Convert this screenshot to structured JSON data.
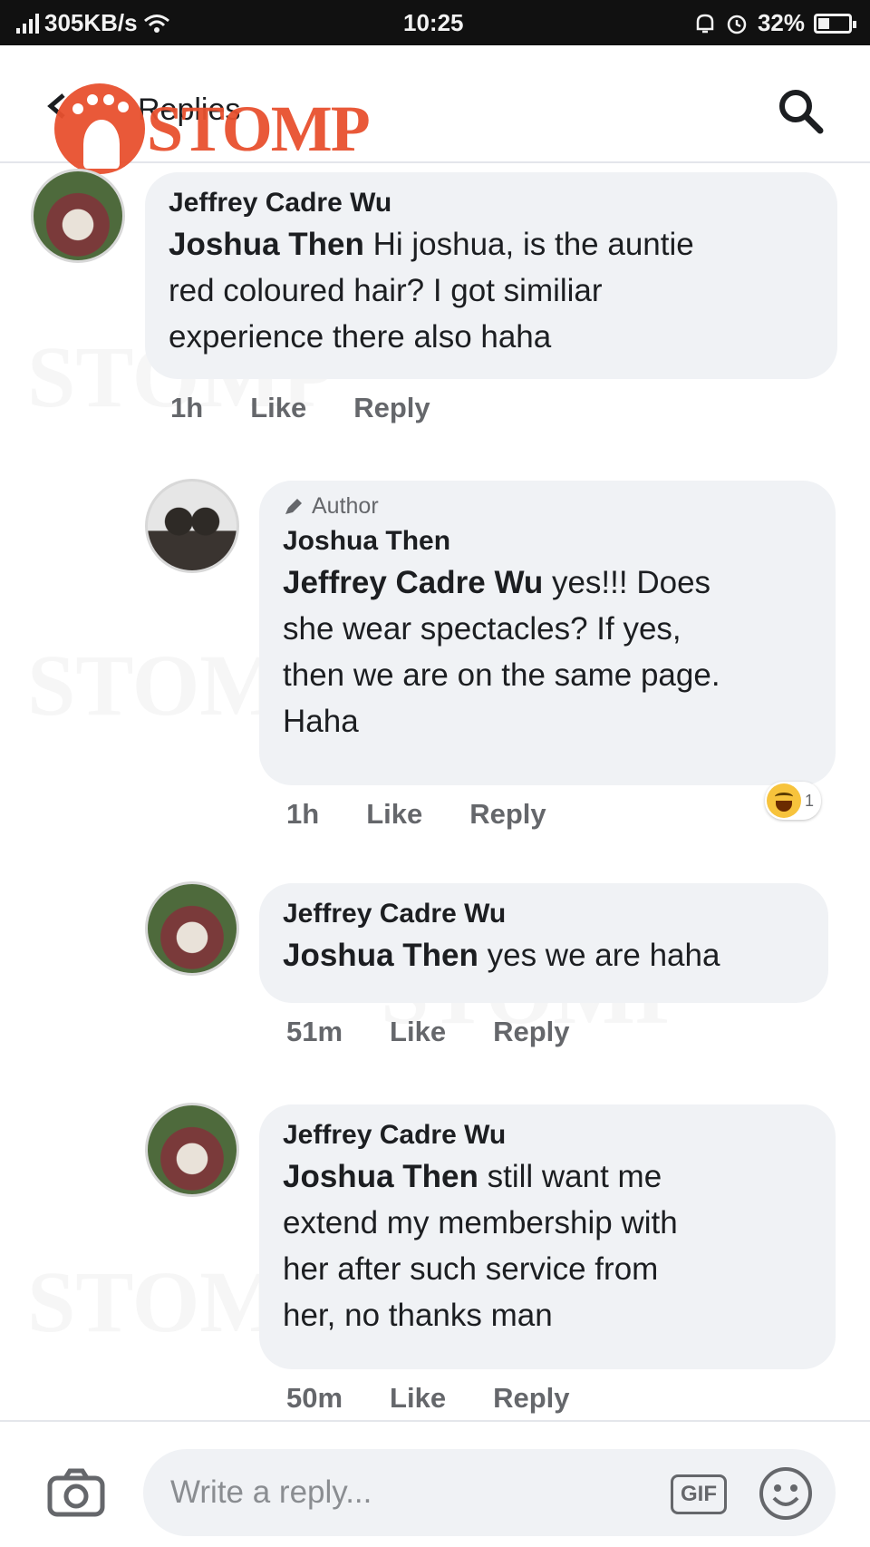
{
  "status_bar": {
    "network_speed": "305KB/s",
    "time": "10:25",
    "battery": "32%"
  },
  "header": {
    "title": "Replies",
    "logo_text": "STOMP"
  },
  "comments": [
    {
      "author": "Jeffrey Cadre Wu",
      "mention": "Joshua Then",
      "lines": [
        "Hi joshua, is the auntie",
        "red coloured hair? I got similiar",
        "experience there also haha"
      ],
      "time": "1h",
      "like": "Like",
      "reply": "Reply"
    },
    {
      "tag": "Author",
      "author": "Joshua Then",
      "mention": "Jeffrey Cadre Wu",
      "lines": [
        "yes!!! Does",
        "she wear spectacles? If yes,",
        "then we are on the same page.",
        "Haha"
      ],
      "time": "1h",
      "like": "Like",
      "reply": "Reply",
      "reaction_count": "1"
    },
    {
      "author": "Jeffrey Cadre Wu",
      "mention": "Joshua Then",
      "lines": [
        "yes we are haha"
      ],
      "time": "51m",
      "like": "Like",
      "reply": "Reply"
    },
    {
      "author": "Jeffrey Cadre Wu",
      "mention": "Joshua Then",
      "lines": [
        "still want me",
        "extend my membership with",
        "her after such service from",
        "her, no thanks man"
      ],
      "time": "50m",
      "like": "Like",
      "reply": "Reply"
    }
  ],
  "reply_bar": {
    "placeholder": "Write a reply...",
    "gif_label": "GIF"
  },
  "icons": {
    "back": "back-arrow-icon",
    "search": "search-icon",
    "camera": "camera-icon",
    "gif": "gif-icon",
    "emoji": "smile-icon",
    "reaction": "haha-reaction-icon"
  },
  "colors": {
    "bubble": "#f0f2f5",
    "meta_text": "#65676b",
    "logo": "#e8512f",
    "status_bar": "#111111"
  }
}
